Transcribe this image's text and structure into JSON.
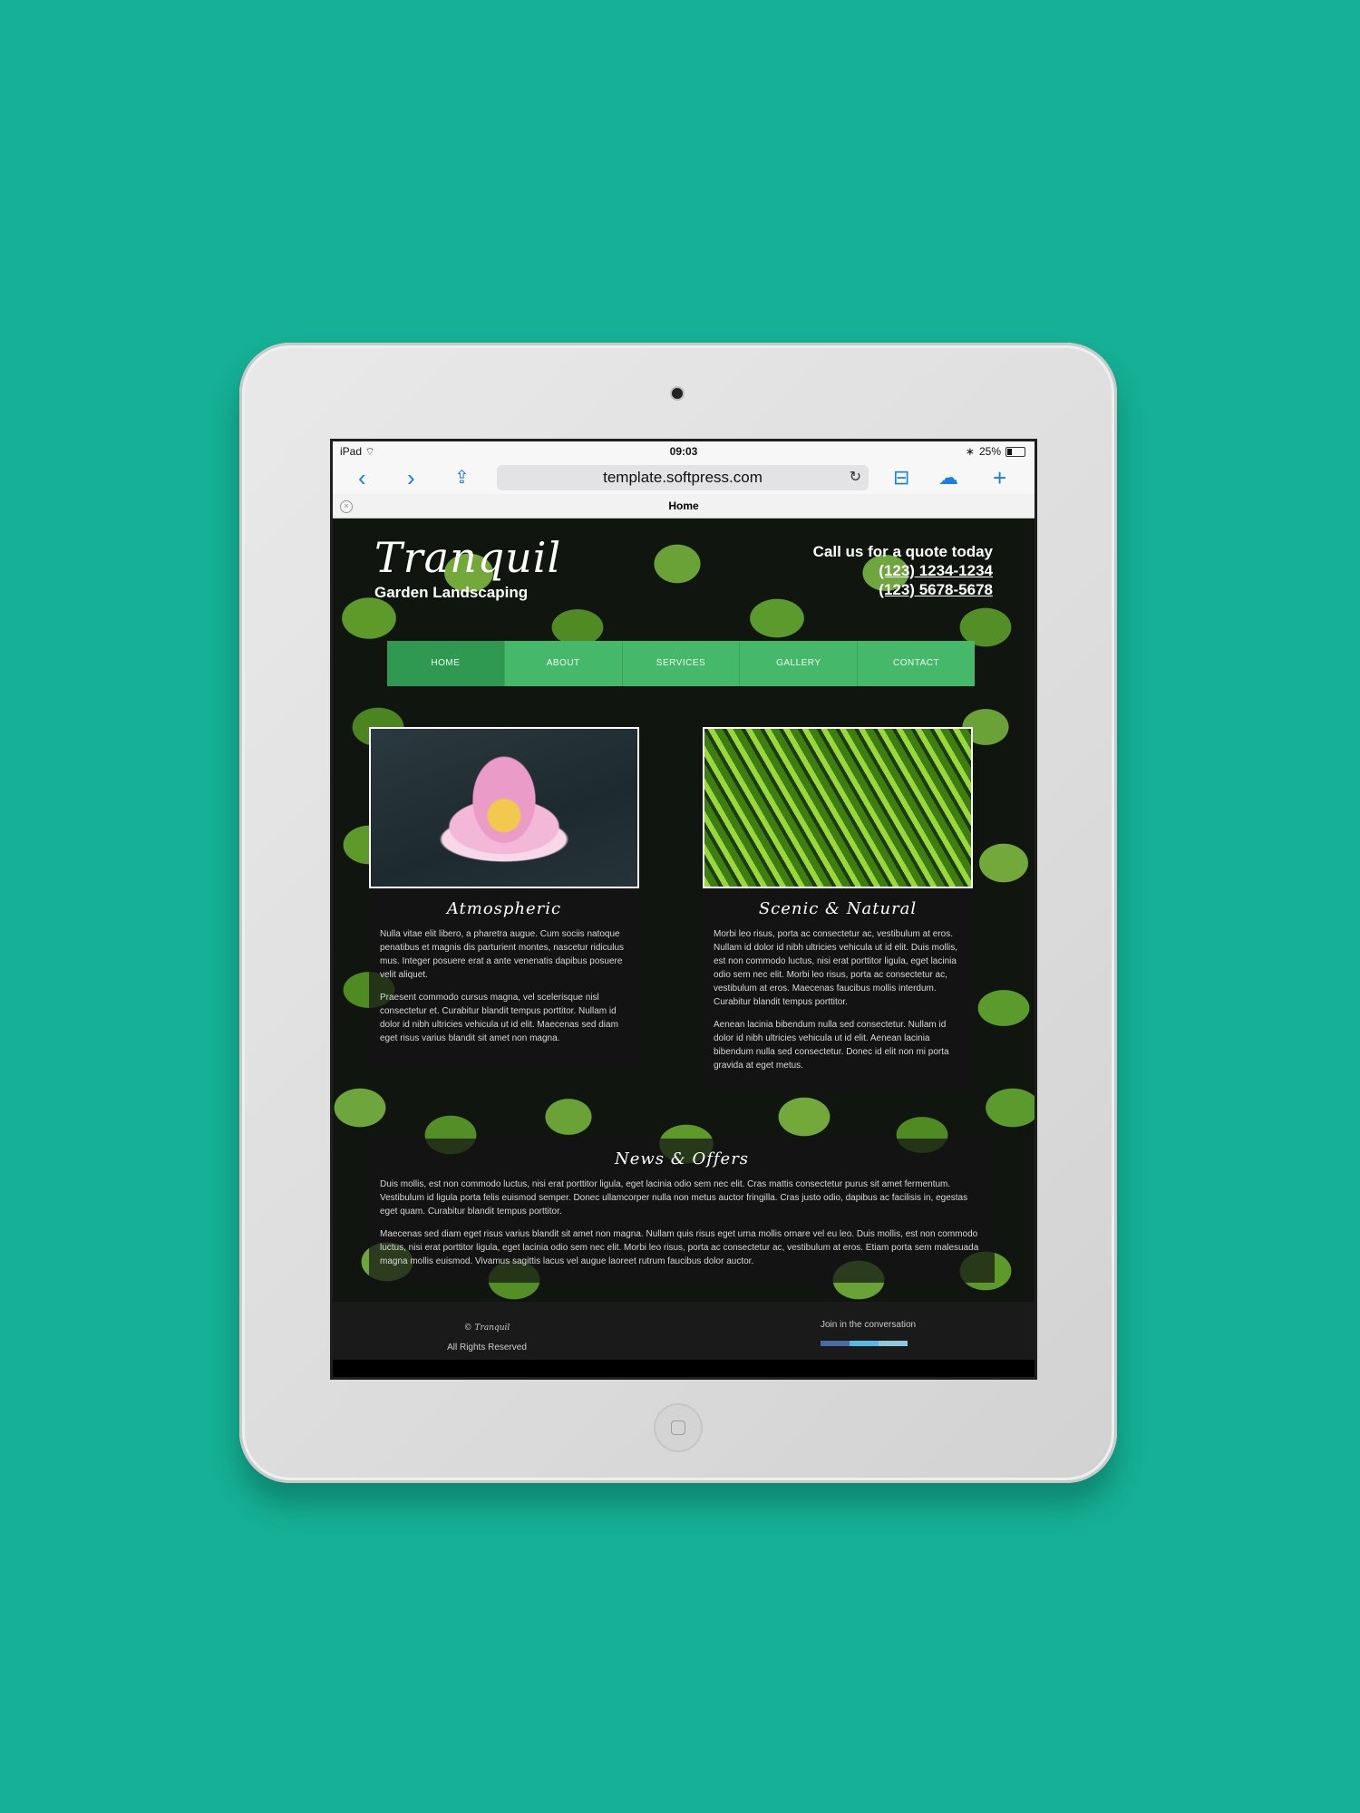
{
  "status_bar": {
    "device": "iPad",
    "time": "09:03",
    "battery": "25%"
  },
  "browser": {
    "url": "template.softpress.com",
    "tab_title": "Home",
    "icons": [
      "back-icon",
      "forward-icon",
      "share-icon",
      "reload-icon",
      "bookmarks-icon",
      "icloud-tabs-icon",
      "new-tab-icon",
      "close-tab-icon"
    ]
  },
  "site": {
    "brand_name": "Tranquil",
    "tagline": "Garden Landscaping",
    "quote_heading": "Call us for a quote today",
    "phones": [
      "(123) 1234-1234",
      "(123) 5678-5678"
    ],
    "nav": [
      {
        "label": "HOME",
        "active": true
      },
      {
        "label": "ABOUT",
        "active": false
      },
      {
        "label": "SERVICES",
        "active": false
      },
      {
        "label": "GALLERY",
        "active": false
      },
      {
        "label": "CONTACT",
        "active": false
      }
    ],
    "columns": [
      {
        "heading": "Atmospheric",
        "paragraphs": [
          "Nulla vitae elit libero, a pharetra augue. Cum sociis natoque penatibus et magnis dis parturient montes, nascetur ridiculus mus. Integer posuere erat a ante venenatis dapibus posuere velit aliquet.",
          "Praesent commodo cursus magna, vel scelerisque nisl consectetur et. Curabitur blandit tempus porttitor. Nullam id dolor id nibh ultricies vehicula ut id elit. Maecenas sed diam eget risus varius blandit sit amet non magna."
        ]
      },
      {
        "heading": "Scenic & Natural",
        "paragraphs": [
          "Morbi leo risus, porta ac consectetur ac, vestibulum at eros. Nullam id dolor id nibh ultricies vehicula ut id elit. Duis mollis, est non commodo luctus, nisi erat porttitor ligula, eget lacinia odio sem nec elit. Morbi leo risus, porta ac consectetur ac, vestibulum at eros. Maecenas faucibus mollis interdum. Curabitur blandit tempus porttitor.",
          "Aenean lacinia bibendum nulla sed consectetur. Nullam id dolor id nibh ultricies vehicula ut id elit. Aenean lacinia bibendum nulla sed consectetur. Donec id elit non mi porta gravida at eget metus."
        ]
      }
    ],
    "news": {
      "heading": "News & Offers",
      "paragraphs": [
        "Duis mollis, est non commodo luctus, nisi erat porttitor ligula, eget lacinia odio sem nec elit. Cras mattis consectetur purus sit amet fermentum. Vestibulum id ligula porta felis euismod semper. Donec ullamcorper nulla non metus auctor fringilla. Cras justo odio, dapibus ac facilisis in, egestas eget quam. Curabitur blandit tempus porttitor.",
        "Maecenas sed diam eget risus varius blandit sit amet non magna. Nullam quis risus eget urna mollis ornare vel eu leo. Duis mollis, est non commodo luctus, nisi erat porttitor ligula, eget lacinia odio sem nec elit. Morbi leo risus, porta ac consectetur ac, vestibulum at eros. Etiam porta sem malesuada magna mollis euismod. Vivamus sagittis lacus vel augue laoreet rutrum faucibus dolor auctor."
      ]
    },
    "footer": {
      "copyright": "© Tranquil",
      "rights": "All Rights Reserved",
      "social_heading": "Join in the conversation",
      "social_colors": [
        "#4a6aa8",
        "#55b8e8",
        "#8ec7de"
      ]
    }
  },
  "colors": {
    "background": "#15b095",
    "nav_bg": "#46b86a",
    "nav_active": "#2f9952",
    "safari_accent": "#1a7fe0"
  }
}
